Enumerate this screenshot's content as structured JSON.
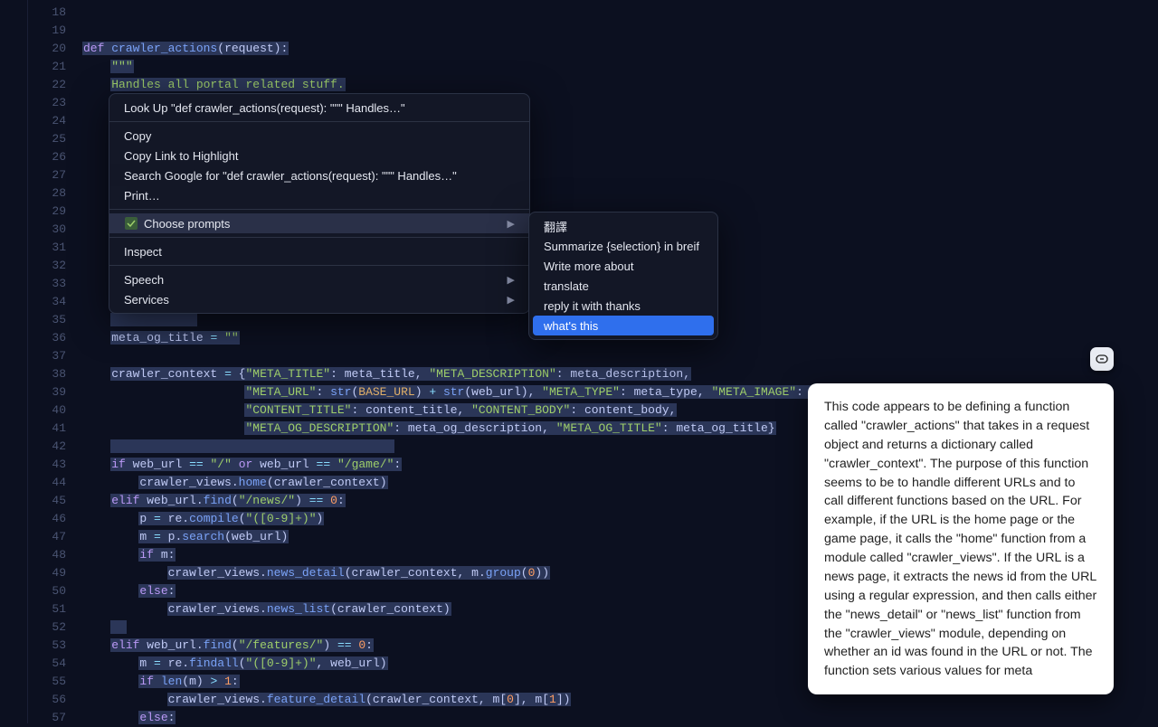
{
  "gutter": {
    "start": 18,
    "end": 57
  },
  "code_lines": [
    {
      "n": 18,
      "html": ""
    },
    {
      "n": 19,
      "html": ""
    },
    {
      "n": 20,
      "html": "<span class='hl'><span class='kw'>def</span> <span class='fn'>crawler_actions</span>(<span class='var'>request</span>):</span>"
    },
    {
      "n": 21,
      "html": "    <span class='hl'><span class='str'>\"\"\"</span></span>"
    },
    {
      "n": 22,
      "html": "    <span class='hl'><span class='str'>Handles all portal related stuff.</span></span>"
    },
    {
      "n": 23,
      "html": ""
    },
    {
      "n": 24,
      "html": ""
    },
    {
      "n": 25,
      "html": ""
    },
    {
      "n": 26,
      "html": "    <span class='hl'>  </span>"
    },
    {
      "n": 27,
      "html": ""
    },
    {
      "n": 28,
      "html": "    <span class='hl'>  </span>"
    },
    {
      "n": 29,
      "html": ""
    },
    {
      "n": 30,
      "html": ""
    },
    {
      "n": 31,
      "html": ""
    },
    {
      "n": 32,
      "html": ""
    },
    {
      "n": 33,
      "html": ""
    },
    {
      "n": 34,
      "html": ""
    },
    {
      "n": 35,
      "html": "    <span class='hl'>            </span>"
    },
    {
      "n": 36,
      "html": "    <span class='hl'><span class='var'>meta_og_title</span> <span class='op'>=</span> <span class='str'>\"\"</span></span>"
    },
    {
      "n": 37,
      "html": ""
    },
    {
      "n": 38,
      "html": "    <span class='hl'><span class='var'>crawler_context</span> <span class='op'>=</span> {<span class='str'>\"META_TITLE\"</span>: <span class='var'>meta_title</span>, <span class='str'>\"META_DESCRIPTION\"</span>: <span class='var'>meta_description</span>,</span>"
    },
    {
      "n": 39,
      "html": "                       <span class='hl'><span class='str'>\"META_URL\"</span>: <span class='fn'>str</span>(<span class='warn'>BASE_URL</span>) <span class='op'>+</span> <span class='fn'>str</span>(<span class='var'>web_url</span>), <span class='str'>\"META_TYPE\"</span>: <span class='var'>meta_type</span>, <span class='str'>\"META_IMAGE\"</span>: <span class='var'>meta_ima</span></span>"
    },
    {
      "n": 40,
      "html": "                       <span class='hl'><span class='str'>\"CONTENT_TITLE\"</span>: <span class='var'>content_title</span>, <span class='str'>\"CONTENT_BODY\"</span>: <span class='var'>content_body</span>,</span>"
    },
    {
      "n": 41,
      "html": "                       <span class='hl'><span class='str'>\"META_OG_DESCRIPTION\"</span>: <span class='var'>meta_og_description</span>, <span class='str'>\"META_OG_TITLE\"</span>: <span class='var'>meta_og_title</span>}</span>"
    },
    {
      "n": 42,
      "html": "    <span class='hl'>                                        </span>"
    },
    {
      "n": 43,
      "html": "    <span class='hl'><span class='kw'>if</span> <span class='var'>web_url</span> <span class='op'>==</span> <span class='str'>\"/\"</span> <span class='kw'>or</span> <span class='var'>web_url</span> <span class='op'>==</span> <span class='str'>\"/game/\"</span>:</span>"
    },
    {
      "n": 44,
      "html": "        <span class='hl'><span class='var'>crawler_views</span>.<span class='fn'>home</span>(<span class='var'>crawler_context</span>)</span>"
    },
    {
      "n": 45,
      "html": "    <span class='hl'><span class='kw'>elif</span> <span class='var'>web_url</span>.<span class='fn'>find</span>(<span class='str'>\"/news/\"</span>) <span class='op'>==</span> <span class='num'>0</span>:</span>"
    },
    {
      "n": 46,
      "html": "        <span class='hl'><span class='var'>p</span> <span class='op'>=</span> <span class='var'>re</span>.<span class='fn'>compile</span>(<span class='str'>\"([0-9]+)\"</span>)</span>"
    },
    {
      "n": 47,
      "html": "        <span class='hl'><span class='var'>m</span> <span class='op'>=</span> <span class='var'>p</span>.<span class='fn'>search</span>(<span class='var'>web_url</span>)</span>"
    },
    {
      "n": 48,
      "html": "        <span class='hl'><span class='kw'>if</span> <span class='var'>m</span>:</span>"
    },
    {
      "n": 49,
      "html": "            <span class='hl'><span class='var'>crawler_views</span>.<span class='fn'>news_detail</span>(<span class='var'>crawler_context</span>, <span class='var'>m</span>.<span class='fn'>group</span>(<span class='num'>0</span>))</span>"
    },
    {
      "n": 50,
      "html": "        <span class='hl'><span class='kw'>else</span>:</span>"
    },
    {
      "n": 51,
      "html": "            <span class='hl'><span class='var'>crawler_views</span>.<span class='fn'>news_list</span>(<span class='var'>crawler_context</span>)</span>"
    },
    {
      "n": 52,
      "html": "    <span class='hl'>  </span>"
    },
    {
      "n": 53,
      "html": "    <span class='hl'><span class='kw'>elif</span> <span class='var'>web_url</span>.<span class='fn'>find</span>(<span class='str'>\"/features/\"</span>) <span class='op'>==</span> <span class='num'>0</span>:</span>"
    },
    {
      "n": 54,
      "html": "        <span class='hl'><span class='var'>m</span> <span class='op'>=</span> <span class='var'>re</span>.<span class='fn'>findall</span>(<span class='str'>\"([0-9]+)\"</span>, <span class='var'>web_url</span>)</span>"
    },
    {
      "n": 55,
      "html": "        <span class='hl'><span class='kw'>if</span> <span class='fn'>len</span>(<span class='var'>m</span>) <span class='op'>&gt;</span> <span class='num'>1</span>:</span>"
    },
    {
      "n": 56,
      "html": "            <span class='hl'><span class='var'>crawler_views</span>.<span class='fn'>feature_detail</span>(<span class='var'>crawler_context</span>, <span class='var'>m</span>[<span class='num'>0</span>], <span class='var'>m</span>[<span class='num'>1</span>])</span>"
    },
    {
      "n": 57,
      "html": "        <span class='hl'><span class='kw'>else</span>:</span>"
    }
  ],
  "context_menu": {
    "lookup": "Look Up \"def crawler_actions(request):    \"\"\"    Handles…\"",
    "copy": "Copy",
    "copy_link": "Copy Link to Highlight",
    "search_google": "Search Google for \"def crawler_actions(request):    \"\"\"    Handles…\"",
    "print": "Print…",
    "choose_prompts": "Choose prompts",
    "inspect": "Inspect",
    "speech": "Speech",
    "services": "Services"
  },
  "submenu": {
    "items": [
      {
        "label": "翻譯",
        "selected": false
      },
      {
        "label": "Summarize {selection} in breif",
        "selected": false
      },
      {
        "label": "Write more about",
        "selected": false
      },
      {
        "label": "translate",
        "selected": false
      },
      {
        "label": "reply it with thanks",
        "selected": false
      },
      {
        "label": "what's this",
        "selected": true
      }
    ]
  },
  "tooltip": {
    "text": "This code appears to be defining a function called \"crawler_actions\" that takes in a request object and returns a dictionary called \"crawler_context\". The purpose of this function seems to be to handle different URLs and to call different functions based on the URL. For example, if the URL is the home page or the game page, it calls the \"home\" function from a module called \"crawler_views\". If the URL is a news page, it extracts the news id from the URL using a regular expression, and then calls either the \"news_detail\" or \"news_list\" function from the \"crawler_views\" module, depending on whether an id was found in the URL or not. The function sets various values for meta"
  }
}
